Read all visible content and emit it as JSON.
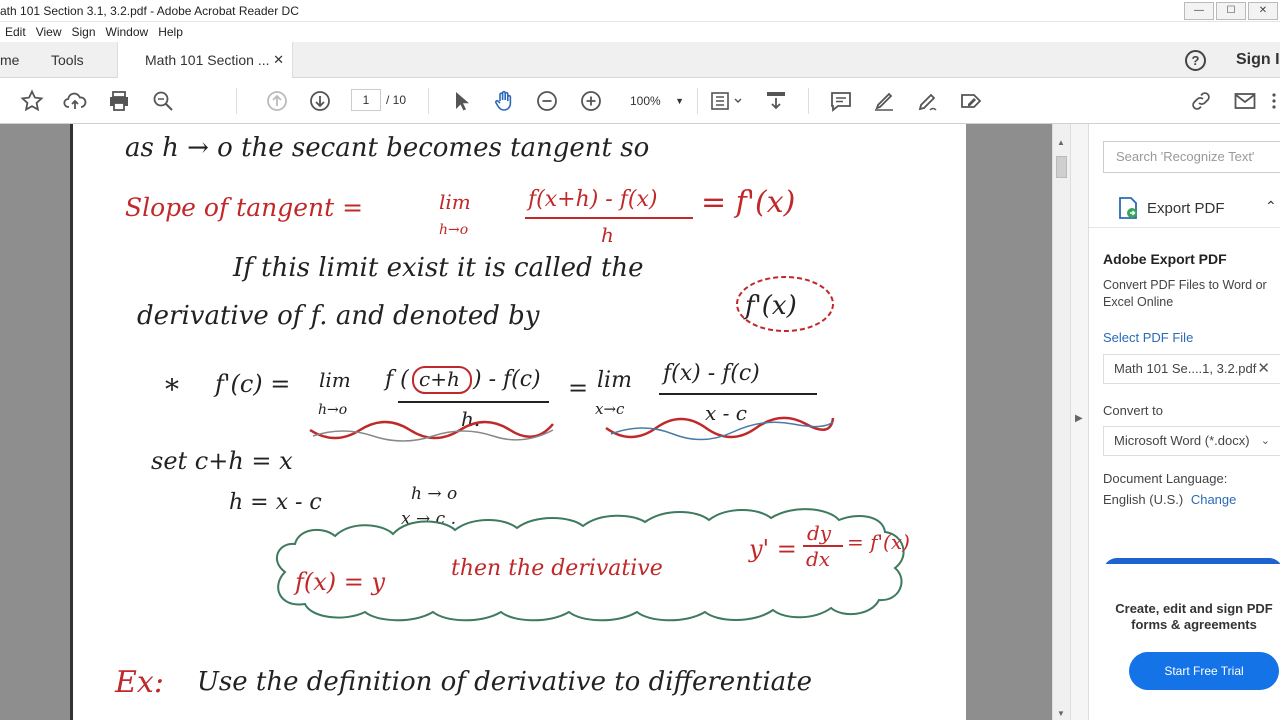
{
  "window": {
    "title": "ath 101 Section 3.1, 3.2.pdf - Adobe Acrobat Reader DC",
    "controls": [
      "—",
      "☐",
      "✕"
    ]
  },
  "menu": [
    "Edit",
    "View",
    "Sign",
    "Window",
    "Help"
  ],
  "tabs": {
    "home": "me",
    "tools": "Tools",
    "document": "Math 101 Section ...",
    "sign_in": "Sign I"
  },
  "toolbar": {
    "page_current": "1",
    "page_total": "/ 10",
    "zoom": "100%"
  },
  "right_panel": {
    "search_placeholder": "Search 'Recognize Text'",
    "export_header": "Export PDF",
    "title": "Adobe Export PDF",
    "description": "Convert PDF Files to Word or Excel Online",
    "select_file": "Select PDF File",
    "file_name": "Math 101 Se....1, 3.2.pdf",
    "convert_to_label": "Convert to",
    "convert_to_value": "Microsoft Word (*.docx)",
    "doc_language_label": "Document Language:",
    "doc_language_value": "English (U.S.)",
    "change_link": "Change",
    "promo_text": "Create, edit and sign PDF forms & agreements",
    "trial_button": "Start Free Trial"
  },
  "document": {
    "line1": "as  h → o   the  secant  becomes  tangent  so",
    "line2_label": "Slope of tangent =",
    "line2_lim": "lim",
    "line2_sub": "h→o",
    "line2_num": "f(x+h) - f(x)",
    "line2_den": "h",
    "line2_res": "= f'(x)",
    "line3": "If  this  limit  exist  it  is  called  the",
    "line4": "derivative  of  f.  and  denoted  by",
    "line4_box": "f'(x)",
    "line5_star": "*",
    "line5_a": "f'(c) =",
    "line5_lim": "lim",
    "line5_sub1": "h→o",
    "line5_num1a": "f (",
    "line5_num1b": "c+h",
    "line5_num1c": ") - f(c)",
    "line5_den1": "h.",
    "line5_eq": "=",
    "line5_lim2": "lim",
    "line5_sub2": "x→c",
    "line5_num2": "f(x) - f(c)",
    "line5_den2": "x - c",
    "line6": "set  c+h = x",
    "line7a": "h = x - c",
    "line7b": "h → o",
    "line7c": "x → c .",
    "cloud_a": "f(x) = y",
    "cloud_b": "then  the  derivative",
    "cloud_c": "y' =",
    "cloud_num": "dy",
    "cloud_den": "dx",
    "cloud_d": "= f'(x)",
    "line9_ex": "Ex:",
    "line9": "Use  the  definition  of  derivative  to  differentiate"
  }
}
